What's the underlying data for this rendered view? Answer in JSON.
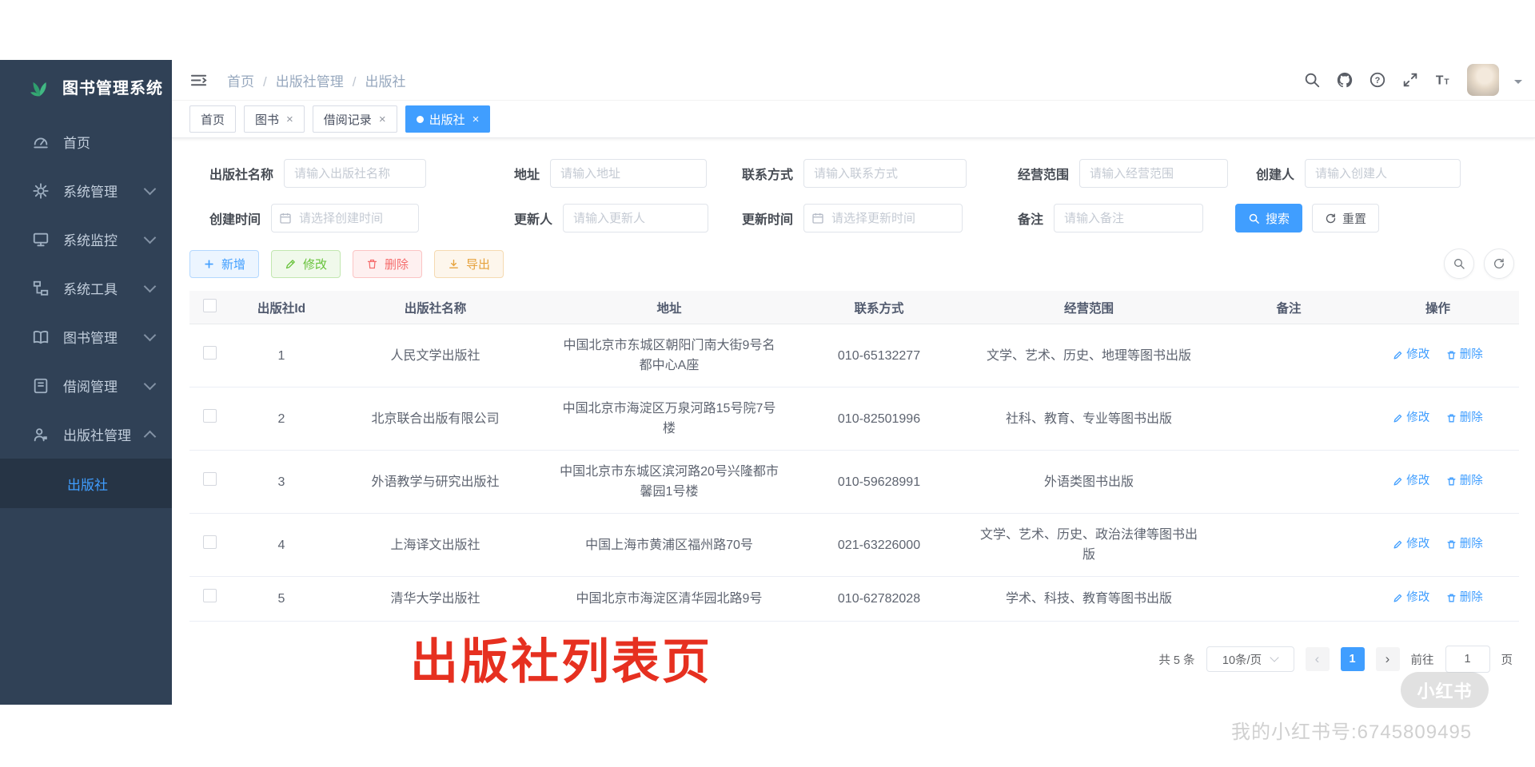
{
  "colors": {
    "accent": "#409eff",
    "success": "#67c23a",
    "danger": "#f56c6c",
    "warning": "#e6a23c",
    "sidebar_bg": "#304156",
    "sidebar_active_bg": "#263445",
    "annotation": "#e63020"
  },
  "app": {
    "title": "图书管理系统"
  },
  "sidebar": {
    "items": [
      {
        "label": "首页",
        "icon": "dashboard-icon",
        "expandable": false,
        "expanded": false
      },
      {
        "label": "系统管理",
        "icon": "gear-icon",
        "expandable": true,
        "expanded": false
      },
      {
        "label": "系统监控",
        "icon": "monitor-icon",
        "expandable": true,
        "expanded": false
      },
      {
        "label": "系统工具",
        "icon": "tool-tree-icon",
        "expandable": true,
        "expanded": false
      },
      {
        "label": "图书管理",
        "icon": "book-icon",
        "expandable": true,
        "expanded": false
      },
      {
        "label": "借阅管理",
        "icon": "reading-icon",
        "expandable": true,
        "expanded": false
      },
      {
        "label": "出版社管理",
        "icon": "publisher-icon",
        "expandable": true,
        "expanded": true
      }
    ],
    "active_submenu": "出版社"
  },
  "header": {
    "breadcrumb": [
      "首页",
      "出版社管理",
      "出版社"
    ]
  },
  "tabs": [
    {
      "label": "首页",
      "closable": false,
      "active": false
    },
    {
      "label": "图书",
      "closable": true,
      "active": false
    },
    {
      "label": "借阅记录",
      "closable": true,
      "active": false
    },
    {
      "label": "出版社",
      "closable": true,
      "active": true
    }
  ],
  "search": {
    "row1": [
      {
        "label": "出版社名称",
        "placeholder": "请输入出版社名称",
        "date": false
      },
      {
        "label": "地址",
        "placeholder": "请输入地址",
        "date": false
      },
      {
        "label": "联系方式",
        "placeholder": "请输入联系方式",
        "date": false
      },
      {
        "label": "经营范围",
        "placeholder": "请输入经营范围",
        "date": false
      },
      {
        "label": "创建人",
        "placeholder": "请输入创建人",
        "date": false
      }
    ],
    "row2": [
      {
        "label": "创建时间",
        "placeholder": "请选择创建时间",
        "date": true
      },
      {
        "label": "更新人",
        "placeholder": "请输入更新人",
        "date": false
      },
      {
        "label": "更新时间",
        "placeholder": "请选择更新时间",
        "date": true
      },
      {
        "label": "备注",
        "placeholder": "请输入备注",
        "date": false
      }
    ],
    "search_label": "搜索",
    "reset_label": "重置"
  },
  "toolbar": {
    "add_label": "新增",
    "edit_label": "修改",
    "delete_label": "删除",
    "export_label": "导出"
  },
  "table": {
    "columns": [
      "出版社Id",
      "出版社名称",
      "地址",
      "联系方式",
      "经营范围",
      "备注",
      "操作"
    ],
    "edit_label": "修改",
    "delete_label": "删除",
    "rows": [
      {
        "id": "1",
        "name": "人民文学出版社",
        "address": "中国北京市东城区朝阳门南大街9号名都中心A座",
        "phone": "010-65132277",
        "scope": "文学、艺术、历史、地理等图书出版",
        "remark": ""
      },
      {
        "id": "2",
        "name": "北京联合出版有限公司",
        "address": "中国北京市海淀区万泉河路15号院7号楼",
        "phone": "010-82501996",
        "scope": "社科、教育、专业等图书出版",
        "remark": ""
      },
      {
        "id": "3",
        "name": "外语教学与研究出版社",
        "address": "中国北京市东城区滨河路20号兴隆都市馨园1号楼",
        "phone": "010-59628991",
        "scope": "外语类图书出版",
        "remark": ""
      },
      {
        "id": "4",
        "name": "上海译文出版社",
        "address": "中国上海市黄浦区福州路70号",
        "phone": "021-63226000",
        "scope": "文学、艺术、历史、政治法律等图书出版",
        "remark": ""
      },
      {
        "id": "5",
        "name": "清华大学出版社",
        "address": "中国北京市海淀区清华园北路9号",
        "phone": "010-62782028",
        "scope": "学术、科技、教育等图书出版",
        "remark": ""
      }
    ]
  },
  "pagination": {
    "total": "共 5 条",
    "page_size": "10条/页",
    "current_page": "1",
    "goto_label": "前往",
    "goto_value": "1",
    "page_unit": "页"
  },
  "icons": {
    "prev": "‹",
    "next": "›",
    "close": "×"
  },
  "watermark": {
    "page_label": "出版社列表页",
    "brand": "小红书",
    "account": "我的小红书号:6745809495"
  }
}
